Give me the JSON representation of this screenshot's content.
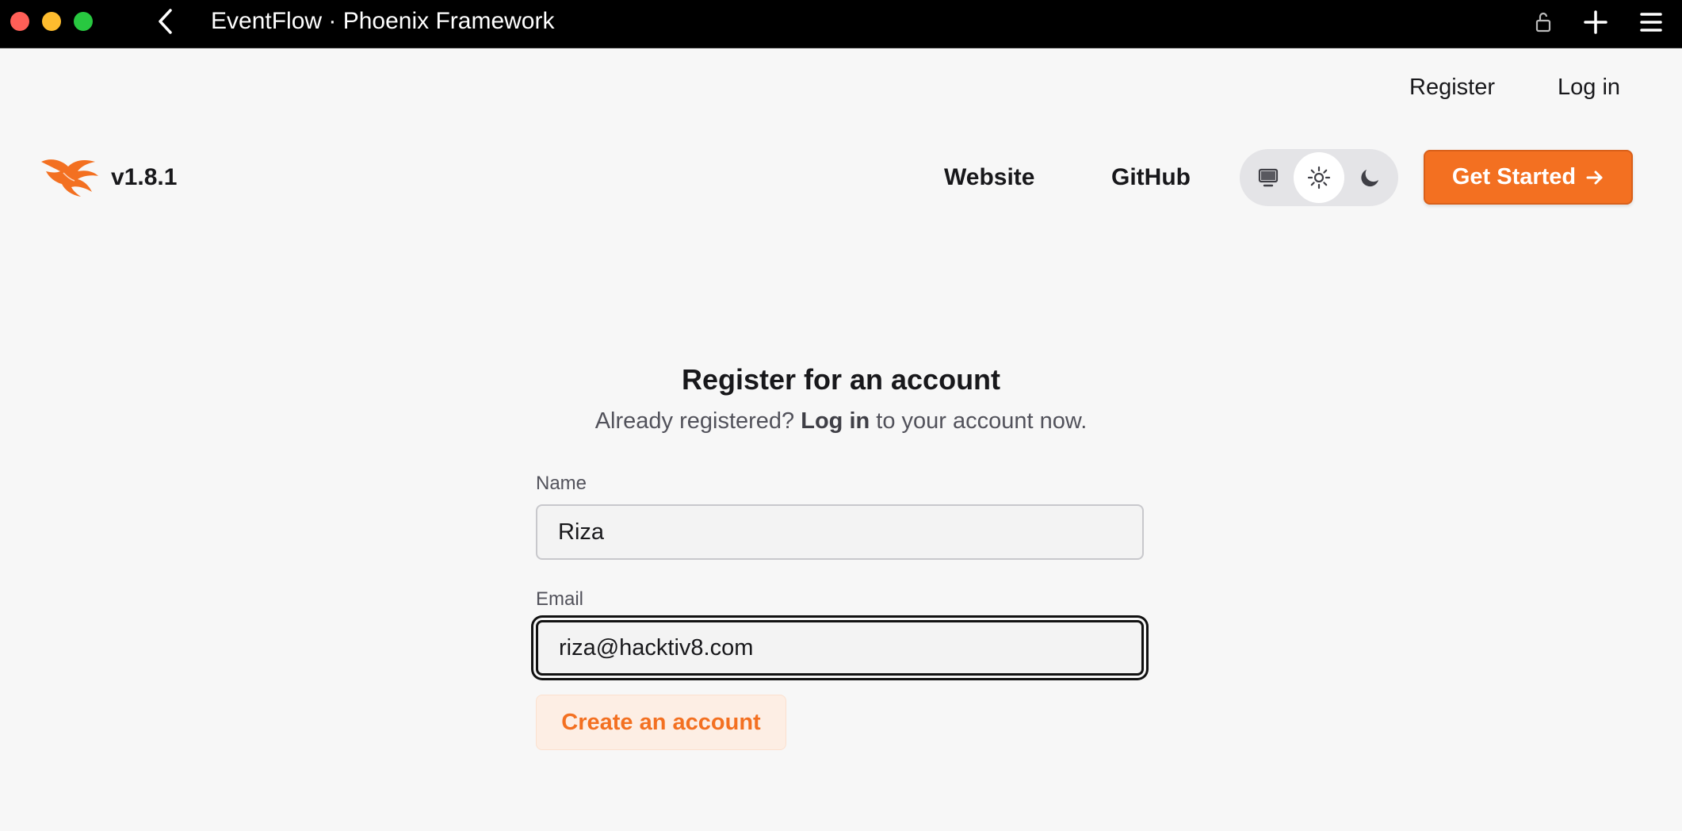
{
  "window": {
    "title": "EventFlow · Phoenix Framework"
  },
  "top_nav": {
    "register_label": "Register",
    "login_label": "Log in"
  },
  "header": {
    "version": "v1.8.1",
    "website_label": "Website",
    "github_label": "GitHub",
    "theme": {
      "options": [
        "system",
        "light",
        "dark"
      ],
      "selected": "light"
    },
    "get_started_label": "Get Started",
    "get_started_icon": "arrow-right-icon"
  },
  "form": {
    "title": "Register for an account",
    "subtitle_prefix": "Already registered?",
    "subtitle_link": "Log in",
    "subtitle_suffix": "to your account now.",
    "name_label": "Name",
    "name_value": "Riza",
    "email_label": "Email",
    "email_value": "riza@hacktiv8.com",
    "submit_label": "Create an account"
  },
  "colors": {
    "accent": "#f37021",
    "accent_light": "#fdeee4",
    "background": "#f7f7f7",
    "titlebar": "#000000"
  }
}
